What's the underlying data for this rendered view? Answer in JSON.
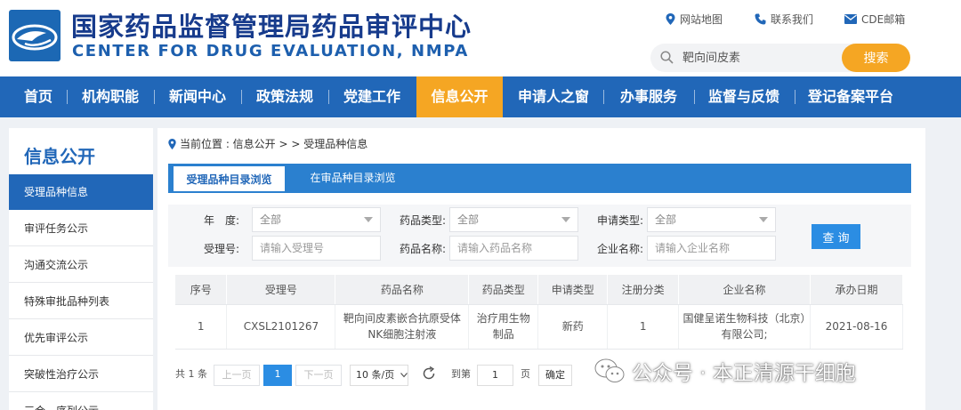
{
  "header": {
    "title_cn": "国家药品监督管理局药品审评中心",
    "title_en": "CENTER FOR DRUG EVALUATION, NMPA",
    "links": [
      {
        "label": "网站地图",
        "icon": "location-pin-icon"
      },
      {
        "label": "联系我们",
        "icon": "phone-icon"
      },
      {
        "label": "CDE邮箱",
        "icon": "mail-icon"
      }
    ],
    "search": {
      "placeholder": "靶向间皮素",
      "button": "搜索"
    }
  },
  "nav": {
    "items": [
      "首页",
      "机构职能",
      "新闻中心",
      "政策法规",
      "党建工作",
      "信息公开",
      "申请人之窗",
      "办事服务",
      "监督与反馈",
      "登记备案平台"
    ],
    "active": "信息公开"
  },
  "sidebar": {
    "title": "信息公开",
    "items": [
      "受理品种信息",
      "审评任务公示",
      "沟通交流公示",
      "特殊审批品种列表",
      "优先审评公示",
      "突破性治疗公示",
      "三合一序列公示"
    ],
    "active": "受理品种信息"
  },
  "breadcrumb": "当前位置 : 信息公开 > > 受理品种信息",
  "tabs": [
    "受理品种目录浏览",
    "在审品种目录浏览"
  ],
  "filters": {
    "year_label": "年　度:",
    "year_value": "全部",
    "drug_type_label": "药品类型:",
    "drug_type_value": "全部",
    "apply_type_label": "申请类型:",
    "apply_type_value": "全部",
    "accept_no_label": "受理号:",
    "accept_no_placeholder": "请输入受理号",
    "drug_name_label": "药品名称:",
    "drug_name_placeholder": "请输入药品名称",
    "company_label": "企业名称:",
    "company_placeholder": "请输入企业名称",
    "query_button": "查 询"
  },
  "table": {
    "headers": [
      "序号",
      "受理号",
      "药品名称",
      "药品类型",
      "申请类型",
      "注册分类",
      "企业名称",
      "承办日期"
    ],
    "rows": [
      [
        "1",
        "CXSL2101267",
        "靶向间皮素嵌合抗原受体NK细胞注射液",
        "治疗用生物制品",
        "新药",
        "1",
        "国健呈诺生物科技（北京）有限公司;",
        "2021-08-16"
      ]
    ]
  },
  "pager": {
    "total": "共 1 条",
    "prev": "上一页",
    "current": "1",
    "next": "下一页",
    "page_size": "10 条/页",
    "goto_label": "到第",
    "goto_value": "1",
    "page_unit": "页",
    "confirm": "确定"
  },
  "watermark": "公众号 · 本正清源干细胞",
  "colors": {
    "brand_blue": "#2167b8",
    "accent_orange": "#f5a623",
    "button_blue": "#2b8de3"
  }
}
